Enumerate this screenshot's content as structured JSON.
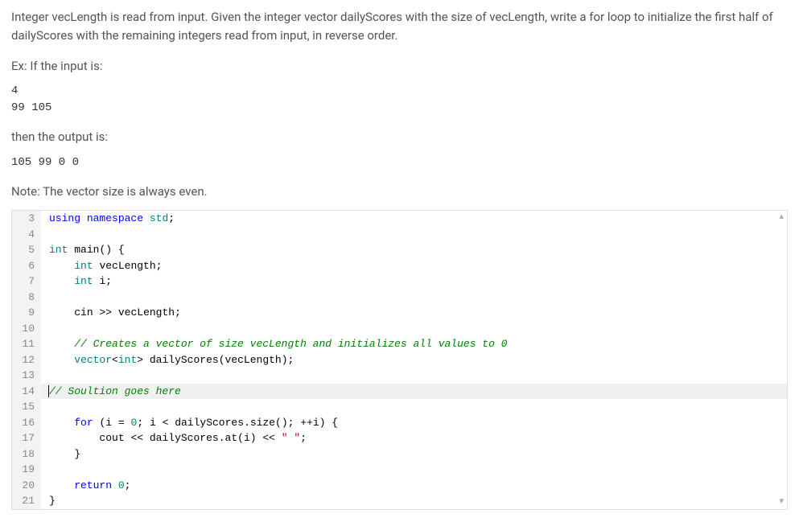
{
  "problem": {
    "description": "Integer vecLength is read from input. Given the integer vector dailyScores with the size of vecLength, write a for loop to initialize the first half of dailyScores with the remaining integers read from input, in reverse order.",
    "ex_label": "Ex: If the input is:",
    "input_example": "4\n99 105",
    "output_label": "then the output is:",
    "output_example": "105 99 0 0",
    "note": "Note: The vector size is always even."
  },
  "editor": {
    "lines": [
      {
        "n": "3",
        "tokens": [
          [
            "kw",
            "using"
          ],
          [
            "plain",
            " "
          ],
          [
            "kw",
            "namespace"
          ],
          [
            "plain",
            " "
          ],
          [
            "ns",
            "std"
          ],
          [
            "op",
            ";"
          ]
        ]
      },
      {
        "n": "4",
        "tokens": []
      },
      {
        "n": "5",
        "tokens": [
          [
            "type",
            "int"
          ],
          [
            "plain",
            " "
          ],
          [
            "func",
            "main"
          ],
          [
            "op",
            "() {"
          ]
        ]
      },
      {
        "n": "6",
        "tokens": [
          [
            "plain",
            "    "
          ],
          [
            "type",
            "int"
          ],
          [
            "plain",
            " "
          ],
          [
            "id",
            "vecLength"
          ],
          [
            "op",
            ";"
          ]
        ]
      },
      {
        "n": "7",
        "tokens": [
          [
            "plain",
            "    "
          ],
          [
            "type",
            "int"
          ],
          [
            "plain",
            " "
          ],
          [
            "id",
            "i"
          ],
          [
            "op",
            ";"
          ]
        ]
      },
      {
        "n": "8",
        "tokens": []
      },
      {
        "n": "9",
        "tokens": [
          [
            "plain",
            "    "
          ],
          [
            "id",
            "cin"
          ],
          [
            "plain",
            " "
          ],
          [
            "op",
            ">>"
          ],
          [
            "plain",
            " "
          ],
          [
            "id",
            "vecLength"
          ],
          [
            "op",
            ";"
          ]
        ]
      },
      {
        "n": "10",
        "tokens": []
      },
      {
        "n": "11",
        "tokens": [
          [
            "plain",
            "    "
          ],
          [
            "comment",
            "// Creates a vector of size vecLength and initializes all values to 0"
          ]
        ]
      },
      {
        "n": "12",
        "tokens": [
          [
            "plain",
            "    "
          ],
          [
            "type",
            "vector"
          ],
          [
            "op",
            "<"
          ],
          [
            "type",
            "int"
          ],
          [
            "op",
            ">"
          ],
          [
            "plain",
            " "
          ],
          [
            "id",
            "dailyScores"
          ],
          [
            "op",
            "("
          ],
          [
            "id",
            "vecLength"
          ],
          [
            "op",
            ");"
          ]
        ]
      },
      {
        "n": "13",
        "tokens": []
      },
      {
        "n": "14",
        "current": true,
        "cursor_at_start": true,
        "tokens": [
          [
            "comment",
            "// Soultion goes here"
          ]
        ]
      },
      {
        "n": "15",
        "tokens": []
      },
      {
        "n": "16",
        "tokens": [
          [
            "plain",
            "    "
          ],
          [
            "kw",
            "for"
          ],
          [
            "plain",
            " "
          ],
          [
            "op",
            "("
          ],
          [
            "id",
            "i"
          ],
          [
            "plain",
            " "
          ],
          [
            "op",
            "="
          ],
          [
            "plain",
            " "
          ],
          [
            "num",
            "0"
          ],
          [
            "op",
            ";"
          ],
          [
            "plain",
            " "
          ],
          [
            "id",
            "i"
          ],
          [
            "plain",
            " "
          ],
          [
            "op",
            "<"
          ],
          [
            "plain",
            " "
          ],
          [
            "id",
            "dailyScores"
          ],
          [
            "op",
            "."
          ],
          [
            "func",
            "size"
          ],
          [
            "op",
            "();"
          ],
          [
            "plain",
            " "
          ],
          [
            "op",
            "++"
          ],
          [
            "id",
            "i"
          ],
          [
            "op",
            ") {"
          ]
        ]
      },
      {
        "n": "17",
        "tokens": [
          [
            "plain",
            "        "
          ],
          [
            "id",
            "cout"
          ],
          [
            "plain",
            " "
          ],
          [
            "op",
            "<<"
          ],
          [
            "plain",
            " "
          ],
          [
            "id",
            "dailyScores"
          ],
          [
            "op",
            "."
          ],
          [
            "func",
            "at"
          ],
          [
            "op",
            "("
          ],
          [
            "id",
            "i"
          ],
          [
            "op",
            ")"
          ],
          [
            "plain",
            " "
          ],
          [
            "op",
            "<<"
          ],
          [
            "plain",
            " "
          ],
          [
            "str",
            "\" \""
          ],
          [
            "op",
            ";"
          ]
        ]
      },
      {
        "n": "18",
        "tokens": [
          [
            "plain",
            "    "
          ],
          [
            "op",
            "}"
          ]
        ]
      },
      {
        "n": "19",
        "tokens": []
      },
      {
        "n": "20",
        "tokens": [
          [
            "plain",
            "    "
          ],
          [
            "kw",
            "return"
          ],
          [
            "plain",
            " "
          ],
          [
            "num",
            "0"
          ],
          [
            "op",
            ";"
          ]
        ]
      },
      {
        "n": "21",
        "tokens": [
          [
            "op",
            "}"
          ]
        ]
      }
    ]
  },
  "scroll": {
    "top_hint": "▴",
    "bottom_hint": "▾"
  }
}
